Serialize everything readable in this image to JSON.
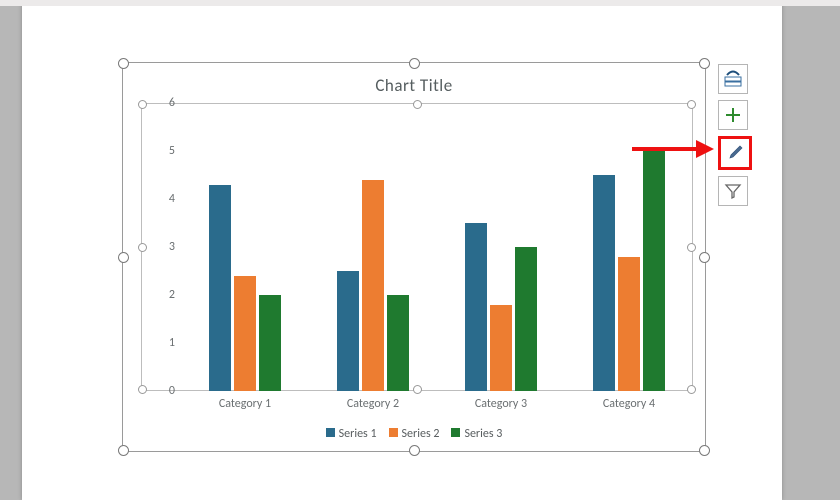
{
  "chart_data": {
    "type": "bar",
    "title": "Chart Title",
    "xlabel": "",
    "ylabel": "",
    "ylim": [
      0,
      6
    ],
    "yticks": [
      0,
      1,
      2,
      3,
      4,
      5,
      6
    ],
    "categories": [
      "Category 1",
      "Category 2",
      "Category 3",
      "Category 4"
    ],
    "series": [
      {
        "name": "Series 1",
        "color": "#2a6b8c",
        "values": [
          4.3,
          2.5,
          3.5,
          4.5
        ]
      },
      {
        "name": "Series 2",
        "color": "#ed7d31",
        "values": [
          2.4,
          4.4,
          1.8,
          2.8
        ]
      },
      {
        "name": "Series 3",
        "color": "#1f7a2f",
        "values": [
          2.0,
          2.0,
          3.0,
          5.0
        ]
      }
    ],
    "legend_position": "bottom",
    "grid": true
  },
  "side_buttons": {
    "layout_options": "Layout Options",
    "chart_elements": "Chart Elements",
    "chart_styles": "Chart Styles",
    "chart_filters": "Chart Filters"
  },
  "colors": {
    "highlight": "#ee1111"
  }
}
